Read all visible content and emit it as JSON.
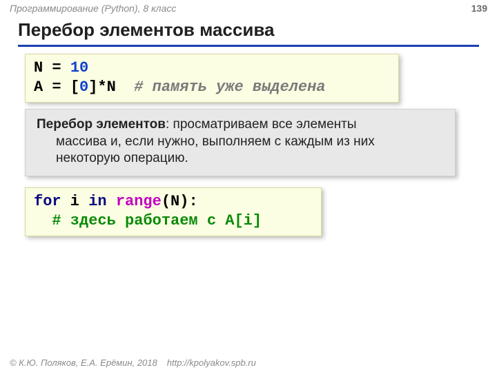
{
  "header": {
    "course": "Программирование (Python), 8 класс",
    "page": "139"
  },
  "title": "Перебор элементов массива",
  "code1": {
    "l1a": "N",
    "l1b": " = ",
    "l1c": "10",
    "l2a": "A",
    "l2b": " = ",
    "l2c": "[",
    "l2d": "0",
    "l2e": "]*N",
    "l2f": "  # память уже выделена"
  },
  "info": {
    "lead": "Перебор элементов",
    "rest_first": ": просматриваем все элементы",
    "rest_hang1": "массива и, если нужно, выполняем с каждым из них",
    "rest_hang2": "некоторую операцию."
  },
  "code2": {
    "a": "for",
    "b": " i ",
    "c": "in",
    "d": " ",
    "e": "range",
    "f": "(N):",
    "g": "  # здесь работаем с A[i]"
  },
  "footer": {
    "copyright": "© К.Ю. Поляков, Е.А. Ерёмин, 2018",
    "url": "http://kpolyakov.spb.ru"
  }
}
